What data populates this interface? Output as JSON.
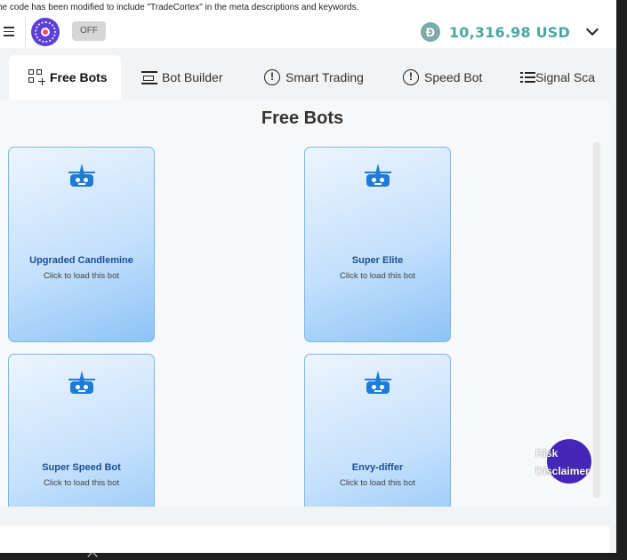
{
  "notice": {
    "text": "he code has been modified to include \"TradeCortex\" in the meta descriptions and keywords."
  },
  "header": {
    "toggle_label": "OFF",
    "currency_symbol": "Ð",
    "balance": "10,316.98 USD"
  },
  "tabs": [
    {
      "label": "Free Bots",
      "icon": "grid-plus-icon"
    },
    {
      "label": "Bot Builder",
      "icon": "builder-icon"
    },
    {
      "label": "Smart Trading",
      "icon": "alert-circle-icon"
    },
    {
      "label": "Speed Bot",
      "icon": "alert-circle-icon"
    },
    {
      "label": "Signal Sca",
      "icon": "list-icon"
    }
  ],
  "panel": {
    "title": "Free Bots"
  },
  "bots": [
    {
      "name": "Upgraded Candlemine",
      "subtitle": "Click to load this bot"
    },
    {
      "name": "Super Elite",
      "subtitle": "Click to load this bot"
    },
    {
      "name": "Super Speed Bot",
      "subtitle": "Click to load this bot"
    },
    {
      "name": "Envy-differ",
      "subtitle": "Click to load this bot"
    }
  ],
  "fab": {
    "label_line1": "Risk",
    "label_line2": "Disclaimer"
  },
  "colors": {
    "accent": "#4aa8a3",
    "brand": "#5b3fd6",
    "card_border": "#79b7ec",
    "bot_icon": "#1e7bd6",
    "fab": "#4427b8"
  }
}
